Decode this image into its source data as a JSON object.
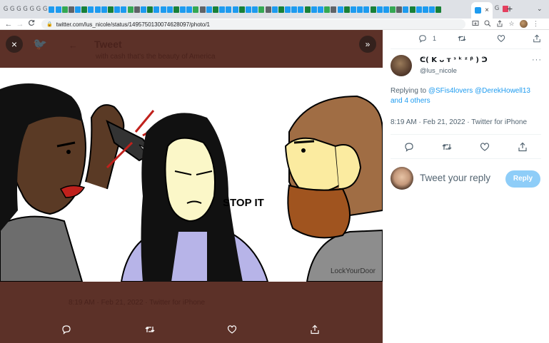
{
  "browser": {
    "tab_glyphs": [
      "G",
      "G",
      "G",
      "G",
      "G",
      "G",
      "G"
    ],
    "active_tab_close": "×",
    "new_tab": "+",
    "tab_menu": "⌄",
    "url": "twitter.com/lus_nicole/status/1495750130074628097/photo/1",
    "nav": {
      "back": "←",
      "forward": "→",
      "reload": "C"
    }
  },
  "viewer": {
    "close_label": "×",
    "expand_label": "»",
    "background_title": "Tweet",
    "background_text": "with cash that's the beauty of America",
    "background_meta": "8:19 AM · Feb 21, 2022 · Twitter for iPhone",
    "image": {
      "speech_text": "STOP IT",
      "watermark": "LockYourDoor"
    }
  },
  "tweet": {
    "top_actions": {
      "reply_count": "1"
    },
    "author": {
      "display_name": "ᕦ( K ᴗ ᴛ ᵌ ᵏ ᶻ ᵝ ) ᕤ",
      "handle": "@lus_nicole"
    },
    "replying_to": {
      "prefix": "Replying to ",
      "mentions": "@SFis4lovers @DerekHowell13 and 4 others"
    },
    "meta": "8:19 AM · Feb 21, 2022 · Twitter for iPhone",
    "reply_box": {
      "placeholder": "Tweet your reply",
      "button": "Reply"
    }
  },
  "colors": {
    "twitter_blue": "#1d9bf0",
    "reply_button_disabled": "#8ecdf8",
    "overlay_backdrop": "#5c3128"
  }
}
